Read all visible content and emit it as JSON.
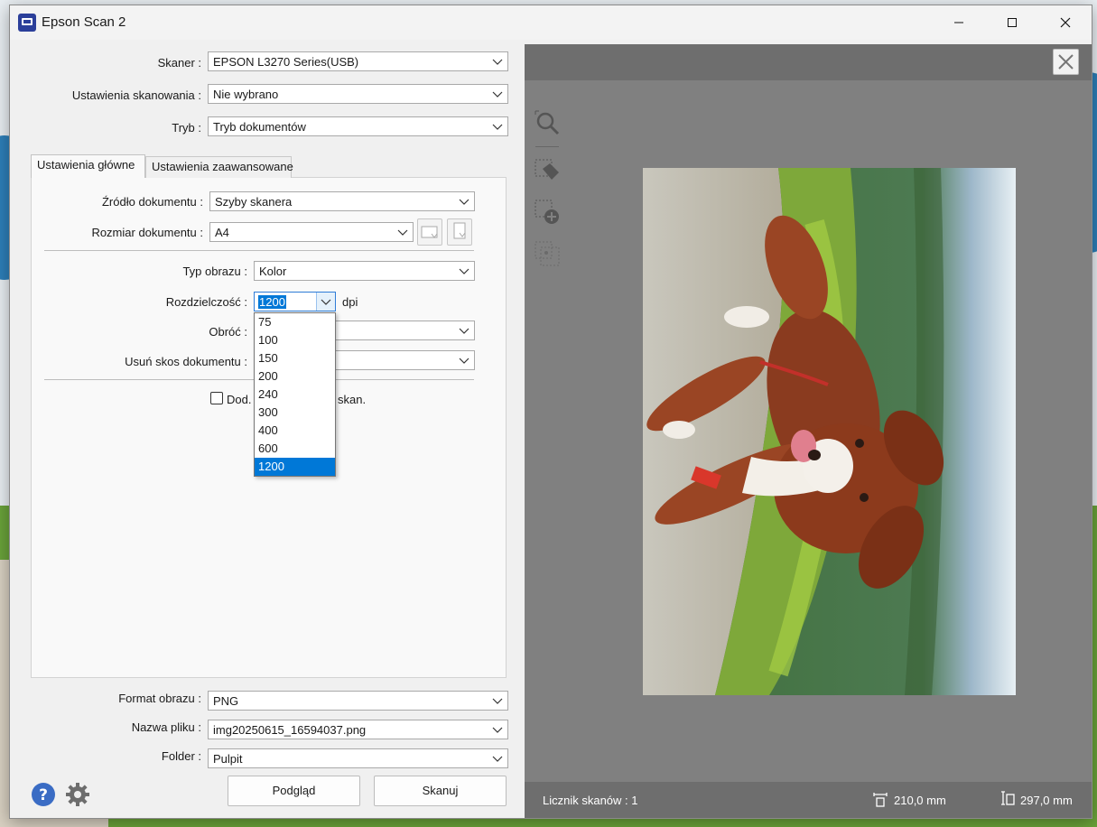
{
  "window": {
    "title": "Epson Scan 2",
    "minimize_icon": "minimize-icon",
    "maximize_icon": "maximize-icon",
    "close_icon": "close-icon"
  },
  "scanner_settings": {
    "scanner": {
      "label": "Skaner :",
      "value": "EPSON L3270 Series(USB)"
    },
    "scan_settings": {
      "label": "Ustawienia skanowania :",
      "value": "Nie wybrano"
    },
    "mode": {
      "label": "Tryb :",
      "value": "Tryb dokumentów"
    }
  },
  "tabs": [
    {
      "label": "Ustawienia główne",
      "active": true
    },
    {
      "label": "Ustawienia zaawansowane",
      "active": false
    }
  ],
  "main_settings": {
    "document_source": {
      "label": "Źródło dokumentu :",
      "value": "Szyby skanera"
    },
    "document_size": {
      "label": "Rozmiar dokumentu :",
      "value": "A4"
    },
    "image_type": {
      "label": "Typ obrazu :",
      "value": "Kolor"
    },
    "resolution": {
      "label": "Rozdzielczość :",
      "value": "1200",
      "unit": "dpi",
      "options": [
        "75",
        "100",
        "150",
        "200",
        "240",
        "300",
        "400",
        "600",
        "1200"
      ],
      "selected": "1200"
    },
    "rotate": {
      "label": "Obróć :",
      "value": ""
    },
    "deskew": {
      "label": "Usuń skos dokumentu :",
      "value": ""
    },
    "add_pages": {
      "label_start": "Dod.",
      "label_end": "skan.",
      "checked": false
    }
  },
  "output": {
    "image_format": {
      "label": "Format obrazu :",
      "value": "PNG"
    },
    "file_name": {
      "label": "Nazwa pliku :",
      "value": "img20250615_16594037.png"
    },
    "folder": {
      "label": "Folder :",
      "value": "Pulpit"
    }
  },
  "buttons": {
    "preview": "Podgląd",
    "scan": "Skanuj",
    "help_icon": "help-icon",
    "settings_icon": "gear-icon"
  },
  "preview_pane": {
    "scan_counter_label": "Licznik skanów : 1",
    "width_value": "210,0 mm",
    "height_value": "297,0 mm",
    "tools": [
      "zoom-icon",
      "auto-crop-icon",
      "add-marquee-icon",
      "remove-marquee-icon"
    ]
  },
  "colors": {
    "accent": "#0078d7",
    "preview_bg": "#808080",
    "preview_bar": "#6e6e6e",
    "help_icon": "#3a6cc4"
  }
}
